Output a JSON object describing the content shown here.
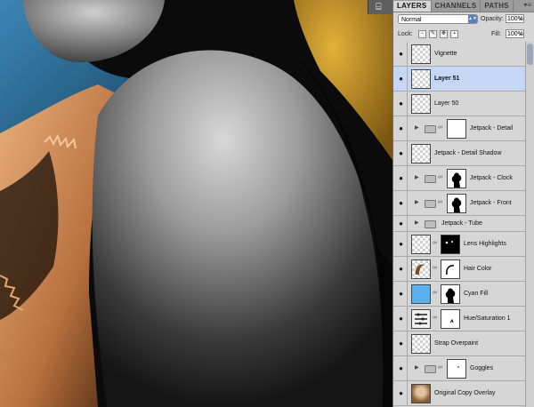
{
  "canvas": {
    "tool_glyph": "⌸"
  },
  "panel": {
    "tabs": [
      {
        "label": "LAYERS",
        "active": true
      },
      {
        "label": "CHANNELS",
        "active": false
      },
      {
        "label": "PATHS",
        "active": false
      }
    ],
    "menu_glyph": "▾≡",
    "blend_mode": "Normal",
    "opacity_label": "Opacity:",
    "opacity_value": "100%",
    "lock_label": "Lock:",
    "fill_label": "Fill:",
    "fill_value": "100%"
  },
  "layers": [
    {
      "name": "Vignette",
      "type": "pixel"
    },
    {
      "name": "Layer 51",
      "type": "pixel",
      "selected": true
    },
    {
      "name": "Layer 50",
      "type": "pixel"
    },
    {
      "name": "Jetpack - Detail",
      "type": "group",
      "mask": "white"
    },
    {
      "name": "Jetpack - Detail Shadow",
      "type": "pixel"
    },
    {
      "name": "Jetpack - Clock",
      "type": "group",
      "mask": "silhouette"
    },
    {
      "name": "Jetpack - Front",
      "type": "group",
      "mask": "silhouette"
    },
    {
      "name": "Jetpack - Tube",
      "type": "group-small"
    },
    {
      "name": "Lens Highlights",
      "type": "masked",
      "mask": "black-dots"
    },
    {
      "name": "Hair Color",
      "type": "masked",
      "mask": "hair"
    },
    {
      "name": "Cyan Fill",
      "type": "masked",
      "thumb": "cyan",
      "mask": "silhouette"
    },
    {
      "name": "Hue/Saturation 1",
      "type": "adjust",
      "mask": "speck"
    },
    {
      "name": "Strap Overpaint",
      "type": "pixel"
    },
    {
      "name": "Goggles",
      "type": "group",
      "mask": "white-dot"
    },
    {
      "name": "Original Copy Overlay",
      "type": "pixel",
      "thumb": "photo"
    }
  ],
  "colors": {
    "selection": "#c5d7f4",
    "panel_bg": "#d6d6d6",
    "cyan_fill": "#5ab1ee",
    "canvas_blue": "#2c6b93",
    "canvas_orange": "#c98c58"
  }
}
